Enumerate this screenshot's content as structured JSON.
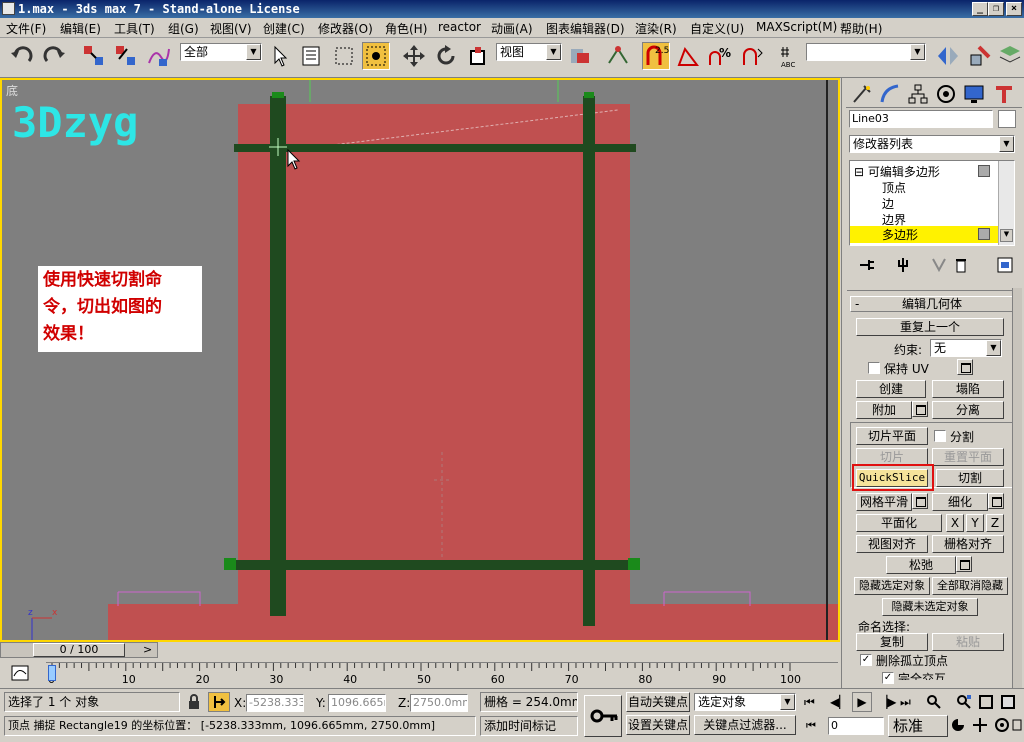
{
  "window": {
    "title": "1.max - 3ds max 7  - Stand-alone License"
  },
  "menu": [
    "文件(F)",
    "编辑(E)",
    "工具(T)",
    "组(G)",
    "视图(V)",
    "创建(C)",
    "修改器(O)",
    "角色(H)",
    "reactor",
    "动画(A)",
    "图表编辑器(D)",
    "渲染(R)",
    "自定义(U)",
    "MAXScript(M)",
    "帮助(H)"
  ],
  "toolbar": {
    "selection_filter": "全部",
    "ref_coord": "视图",
    "snap_value": "2.5",
    "named_selection": ""
  },
  "viewport": {
    "label": "底",
    "watermark": "3Dzyg",
    "note": "使用快速切割命\n令，切出如图的\n效果！",
    "axis_x": "x",
    "axis_y": "z"
  },
  "command_panel": {
    "object_name": "Line03",
    "modifier_list": "修改器列表",
    "stack": [
      {
        "label": "可编辑多边形",
        "prefix": "⊟"
      },
      {
        "label": "顶点"
      },
      {
        "label": "边"
      },
      {
        "label": "边界"
      },
      {
        "label": "多边形",
        "selected": true
      }
    ],
    "rollout_title": "编辑几何体",
    "repeat_last": "重复上一个",
    "constraint_label": "约束:",
    "constraint_value": "无",
    "preserve_uv": "保持 UV",
    "create": "创建",
    "collapse": "塌陷",
    "attach": "附加",
    "detach": "分离",
    "slice_plane": "切片平面",
    "split": "分割",
    "slice": "切片",
    "reset_plane": "重置平面",
    "quickslice": "QuickSlice",
    "cut": "切割",
    "msmooth": "网格平滑",
    "tessellate": "细化",
    "make_planar": "平面化",
    "x": "X",
    "y": "Y",
    "z": "Z",
    "view_align": "视图对齐",
    "grid_align": "栅格对齐",
    "relax": "松弛",
    "hide_selected": "隐藏选定对象",
    "unhide_all": "全部取消隐藏",
    "hide_unselected": "隐藏未选定对象",
    "named_selections": "命名选择:",
    "copy": "复制",
    "paste": "粘贴",
    "delete_isolated": "删除孤立顶点",
    "full_interactivity": "完全交互"
  },
  "timeline": {
    "frame_display": "0 / 100",
    "prev": "<",
    "next": ">",
    "ticks": [
      "0",
      "10",
      "20",
      "30",
      "40",
      "50",
      "60",
      "70",
      "80",
      "90",
      "100"
    ]
  },
  "status": {
    "selection": "选择了 1 个 对象",
    "prompt": "顶点 捕捉 Rectangle19 的坐标位置： [-5238.333mm, 1096.665mm, 2750.0mm]",
    "x_label": "X:",
    "x_value": "-5238.333",
    "y_label": "Y:",
    "y_value": "1096.665m",
    "z_label": "Z:",
    "z_value": "2750.0mm",
    "grid": "栅格 = 254.0mm",
    "add_time_tag": "添加时间标记",
    "auto_key": "自动关键点",
    "set_key": "设置关键点",
    "selected_objects": "选定对象",
    "key_filters": "关键点过滤器...",
    "current_frame": "0",
    "view_mode": "标准"
  }
}
